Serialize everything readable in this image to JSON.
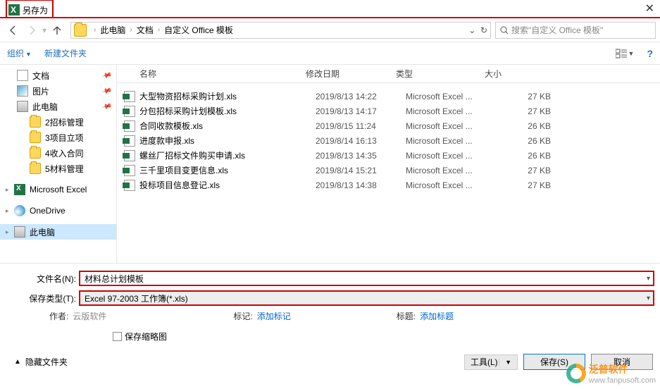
{
  "title": "另存为",
  "breadcrumb": {
    "pc": "此电脑",
    "docs": "文档",
    "folder": "自定义 Office 模板"
  },
  "search": {
    "placeholder": "搜索\"自定义 Office 模板\""
  },
  "toolbar": {
    "organize": "组织",
    "newfolder": "新建文件夹"
  },
  "columns": {
    "name": "名称",
    "date": "修改日期",
    "type": "类型",
    "size": "大小"
  },
  "sidebar": {
    "docs": "文档",
    "pics": "图片",
    "pc": "此电脑",
    "f1": "2招标管理",
    "f2": "3项目立项",
    "f3": "4收入合同",
    "f4": "5材料管理",
    "excel": "Microsoft Excel",
    "onedrive": "OneDrive",
    "thispc": "此电脑"
  },
  "files": [
    {
      "name": "大型物资招标采购计划.xls",
      "date": "2019/8/13 14:22",
      "type": "Microsoft Excel ...",
      "size": "27 KB"
    },
    {
      "name": "分包招标采购计划模板.xls",
      "date": "2019/8/13 14:17",
      "type": "Microsoft Excel ...",
      "size": "27 KB"
    },
    {
      "name": "合同收款模板.xls",
      "date": "2019/8/15 11:24",
      "type": "Microsoft Excel ...",
      "size": "26 KB"
    },
    {
      "name": "进度款申报.xls",
      "date": "2019/8/14 16:13",
      "type": "Microsoft Excel ...",
      "size": "26 KB"
    },
    {
      "name": "螺丝厂招标文件购买申请.xls",
      "date": "2019/8/13 14:35",
      "type": "Microsoft Excel ...",
      "size": "26 KB"
    },
    {
      "name": "三千里项目变更信息.xls",
      "date": "2019/8/14 15:21",
      "type": "Microsoft Excel ...",
      "size": "27 KB"
    },
    {
      "name": "投标项目信息登记.xls",
      "date": "2019/8/13 14:38",
      "type": "Microsoft Excel ...",
      "size": "27 KB"
    }
  ],
  "form": {
    "filename_label": "文件名(N):",
    "filename_value": "材料总计划模板",
    "filetype_label": "保存类型(T):",
    "filetype_value": "Excel 97-2003 工作簿(*.xls)",
    "author_label": "作者:",
    "author_value": "云版软件",
    "tags_label": "标记:",
    "tags_value": "添加标记",
    "title_label": "标题:",
    "title_value": "添加标题",
    "thumb_label": "保存缩略图"
  },
  "footer": {
    "hide_folders": "隐藏文件夹",
    "tools": "工具(L)",
    "save": "保存(S)",
    "cancel": "取消"
  },
  "watermark": {
    "brand": "泛普软件",
    "url": "www.fanpusoft.com"
  }
}
